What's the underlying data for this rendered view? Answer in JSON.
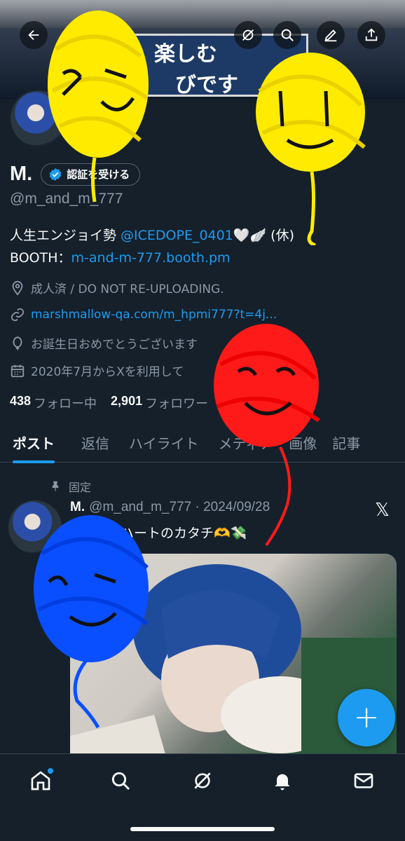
{
  "banner": {
    "sign_line1": "楽しむ",
    "sign_line2": "びです"
  },
  "header": {
    "back_icon": "arrow-left-icon",
    "grok_icon": "grok-icon",
    "search_icon": "search-icon",
    "compose_icon": "compose-icon",
    "share_icon": "share-icon"
  },
  "profile": {
    "display_name": "M.",
    "verify_label": "認証を受ける",
    "handle": "@m_and_m_777",
    "bio_prefix": "人生エンジョイ勢 ",
    "bio_mention": "@ICEDOPE_0401",
    "bio_suffix": "🤍🪽 (休)",
    "booth_label": "BOOTH：",
    "booth_link": "m-and-m-777.booth.pm",
    "location": "成人済 / DO NOT RE-UPLOADING.",
    "website": "marshmallow-qa.com/m_hpmi777?t=4j...",
    "birthday": "お誕生日おめでとうございます",
    "joined": "2020年7月からXを利用して",
    "following_count": "438",
    "following_label": "フォロー中",
    "followers_count": "2,901",
    "followers_label": "フォロワー"
  },
  "tabs": [
    "ポスト",
    "返信",
    "ハイライト",
    "メディア",
    "画像",
    "記事"
  ],
  "post": {
    "pinned_label": "固定",
    "name": "M.",
    "handle_date": "@m_and_m_777 · 2024/09/28",
    "text": "ハートのカタチ🫶💸",
    "x_logo": "𝕏"
  },
  "fab_label": "+",
  "nav": [
    "home-icon",
    "search-icon",
    "grok-icon",
    "notifications-icon",
    "messages-icon"
  ],
  "colors": {
    "background": "#15202b",
    "accent": "#1d9bf0",
    "secondary_text": "#8b98a5",
    "scribble_yellow": "#ffeb00",
    "scribble_red": "#ff1a1a",
    "scribble_blue": "#0a4fff"
  }
}
